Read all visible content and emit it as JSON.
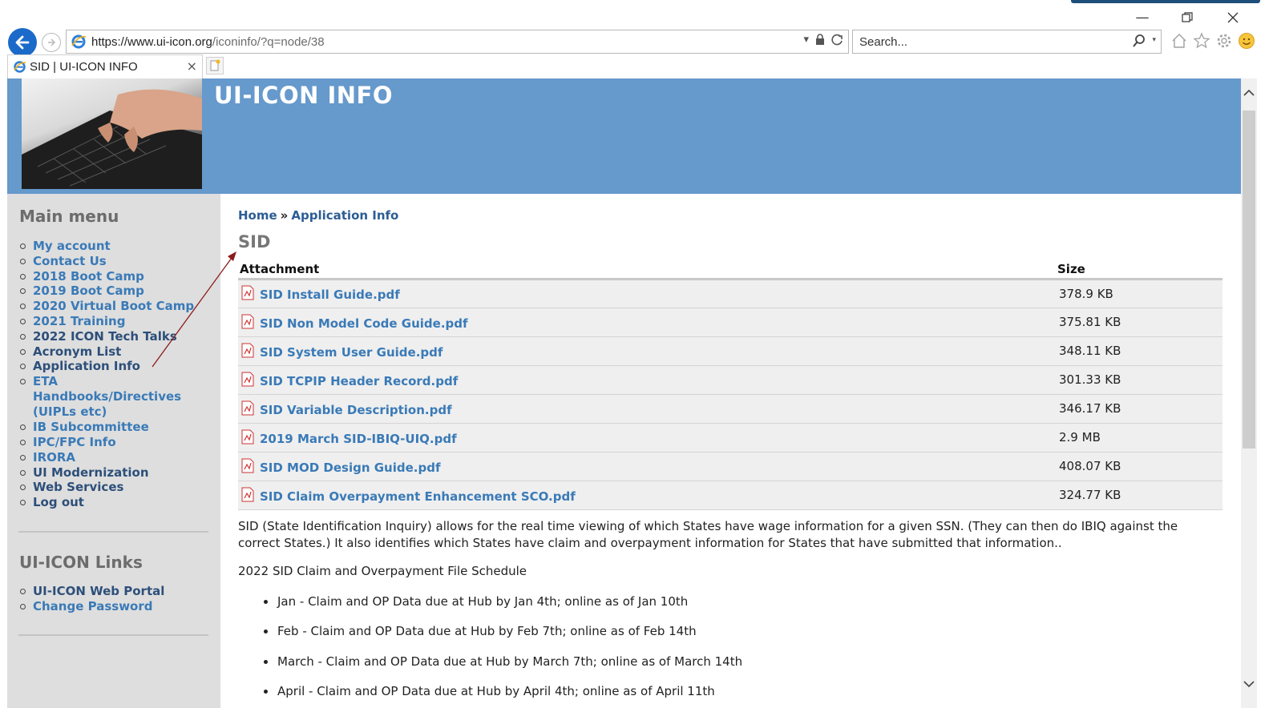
{
  "browser": {
    "url_host": "https://www.ui-icon.org",
    "url_path": "/iconinfo/?q=node/38",
    "search_placeholder": "Search...",
    "tab_title": "SID | UI-ICON INFO"
  },
  "site": {
    "title": "UI-ICON INFO"
  },
  "sidebar": {
    "main_menu_title": "Main menu",
    "main_menu": [
      "My account",
      "Contact Us",
      "2018 Boot Camp",
      "2019 Boot Camp",
      "2020 Virtual Boot Camp",
      "2021 Training",
      "2022 ICON Tech Talks",
      "Acronym List",
      "Application Info",
      "ETA",
      "Handbooks/Directives",
      "(UIPLs etc)",
      "IB Subcommittee",
      "IPC/FPC Info",
      "IRORA",
      "UI Modernization",
      "Web Services",
      "Log out"
    ],
    "links_title": "UI-ICON Links",
    "links": [
      "UI-ICON Web Portal",
      "Change Password"
    ]
  },
  "content": {
    "breadcrumb_home": "Home",
    "breadcrumb_separator": "»",
    "breadcrumb_current": "Application Info",
    "title": "SID",
    "table_headers": {
      "attachment": "Attachment",
      "size": "Size"
    },
    "attachments": [
      {
        "name": "SID Install Guide.pdf",
        "size": "378.9 KB"
      },
      {
        "name": "SID Non Model Code Guide.pdf",
        "size": "375.81 KB"
      },
      {
        "name": "SID System User Guide.pdf",
        "size": "348.11 KB"
      },
      {
        "name": "SID TCPIP Header Record.pdf",
        "size": "301.33 KB"
      },
      {
        "name": "SID Variable Description.pdf",
        "size": "346.17 KB"
      },
      {
        "name": "2019 March SID-IBIQ-UIQ.pdf",
        "size": "2.9 MB"
      },
      {
        "name": "SID MOD Design Guide.pdf",
        "size": "408.07 KB"
      },
      {
        "name": "SID Claim Overpayment Enhancement SCO.pdf",
        "size": "324.77 KB"
      }
    ],
    "description": "SID (State Identification Inquiry) allows for the real time viewing of which States have wage information for a given SSN. (They can then do IBIQ against the correct States.) It also identifies which States have claim and overpayment information for States that have submitted that information..",
    "schedule_title": "2022 SID Claim and Overpayment File Schedule",
    "schedule": [
      "Jan - Claim and OP Data due at Hub by Jan 4th; online as of Jan 10th",
      "Feb - Claim and OP Data due at Hub by Feb 7th; online as of Feb 14th",
      "March - Claim and OP Data due at Hub by March 7th; online as of March 14th",
      "April - Claim and OP Data due at Hub by April 4th; online as of April 11th"
    ]
  },
  "colors": {
    "header_blue": "#6699cc",
    "link_blue": "#3a7ab7",
    "sidebar_gray": "#dedede",
    "annotation_red": "#8b1a1a"
  }
}
